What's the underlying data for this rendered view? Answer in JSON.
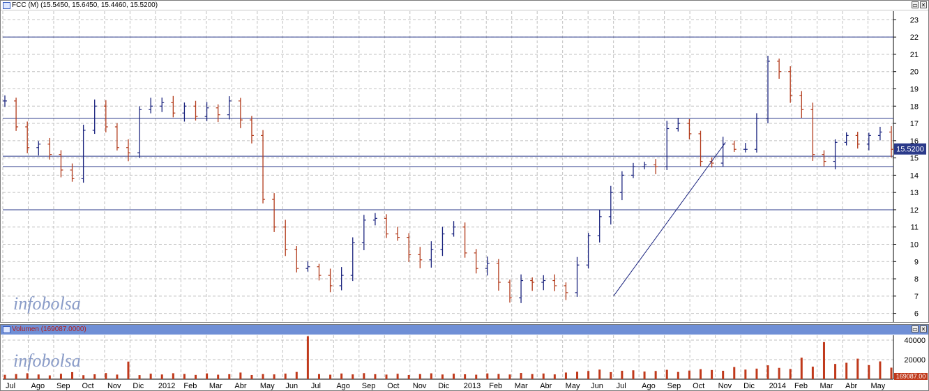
{
  "price_panel": {
    "title": "FCC (M) (15.5450, 15.6450, 15.4460, 15.5200)",
    "last_price_label": "15.5200",
    "watermark": "infobolsa"
  },
  "volume_panel": {
    "title": "Volumen (169087.0000)",
    "last_volume_label": "169087.00",
    "watermark": "infobolsa"
  },
  "window_buttons": {
    "restore": "▭",
    "close": "✕"
  },
  "colors": {
    "up_bar": "#1a237e",
    "down_bar": "#b23a1a",
    "grid": "#c0c0c0",
    "hline": "#2b3a8a",
    "volume_bar": "#c0391b",
    "last_price_bg": "#2b3a8a"
  },
  "chart_data": [
    {
      "type": "line",
      "style": "ohlc-bars",
      "ylim": [
        5.5,
        23.5
      ],
      "yticks": [
        6,
        7,
        8,
        9,
        10,
        11,
        12,
        13,
        14,
        15,
        16,
        17,
        18,
        19,
        20,
        21,
        22,
        23
      ],
      "grid": true,
      "months": [
        "Jul",
        "Ago",
        "Sep",
        "Oct",
        "Nov",
        "Dic",
        "2012",
        "Feb",
        "Mar",
        "Abr",
        "May",
        "Jun",
        "Jul",
        "Ago",
        "Sep",
        "Oct",
        "Nov",
        "Dic",
        "2013",
        "Feb",
        "Mar",
        "Abr",
        "May",
        "Jun",
        "Jul",
        "Ago",
        "Sep",
        "Oct",
        "Nov",
        "Dic",
        "2014",
        "Feb",
        "Mar",
        "Abr",
        "May"
      ],
      "series": [
        {
          "values": [
            18.3,
            16.8,
            15.6,
            15.8,
            15.2,
            14.3,
            13.8,
            16.6,
            18.0,
            16.8,
            15.6,
            15.3,
            17.8,
            18.0,
            18.2,
            17.6,
            18.0,
            17.4,
            17.9,
            17.5,
            18.3,
            17.2,
            16.3,
            12.6,
            11.0,
            9.7,
            8.6,
            8.7,
            8.2,
            7.6,
            8.2,
            10.1,
            11.4,
            11.5,
            10.6,
            10.4,
            9.4,
            9.1,
            9.7,
            10.6,
            11.0,
            9.5,
            8.6,
            8.9,
            7.8,
            6.9,
            7.9,
            7.8,
            7.9,
            7.6,
            7.2,
            8.8,
            10.5,
            11.6,
            13.0,
            14.0,
            14.5,
            14.6,
            14.5,
            16.7,
            17.0,
            16.4,
            14.8,
            14.7,
            15.8,
            15.5,
            15.5,
            17.3,
            20.6,
            20.0,
            18.6,
            17.8,
            15.2,
            14.8,
            15.9,
            16.3,
            15.8,
            16.3,
            16.5,
            15.5
          ]
        }
      ],
      "horizontal_lines": [
        22.0,
        17.3,
        15.1,
        14.5,
        12.0
      ],
      "trendline": {
        "from": {
          "month_index": 24,
          "value": 7.0
        },
        "to": {
          "month_index": 28.4,
          "value": 15.9
        }
      }
    },
    {
      "type": "bar",
      "ylim": [
        0,
        45000
      ],
      "yticks": [
        20000,
        40000
      ],
      "ytick_labels": [
        "20000",
        "40000"
      ],
      "series": [
        {
          "values": [
            4500,
            5200,
            6100,
            4800,
            3900,
            5500,
            7200,
            4100,
            5000,
            6300,
            4700,
            18000,
            4200,
            5600,
            4800,
            6100,
            5300,
            4400,
            5900,
            4600,
            5100,
            6800,
            4300,
            5200,
            4900,
            5700,
            7400,
            44000,
            5200,
            4600,
            5800,
            4900,
            6200,
            5100,
            4700,
            5500,
            4300,
            5200,
            6000,
            4800,
            5600,
            5000,
            4600,
            5900,
            5300,
            4800,
            6400,
            5200,
            5800,
            4900,
            6800,
            7600,
            8400,
            9800,
            7200,
            8600,
            9100,
            7800,
            8400,
            9600,
            7400,
            8800,
            10200,
            9400,
            8600,
            12400,
            9800,
            10800,
            14200,
            11600,
            10400,
            22000,
            12800,
            38000,
            15600,
            16800,
            21000,
            14400,
            18200,
            11800
          ]
        }
      ]
    }
  ]
}
